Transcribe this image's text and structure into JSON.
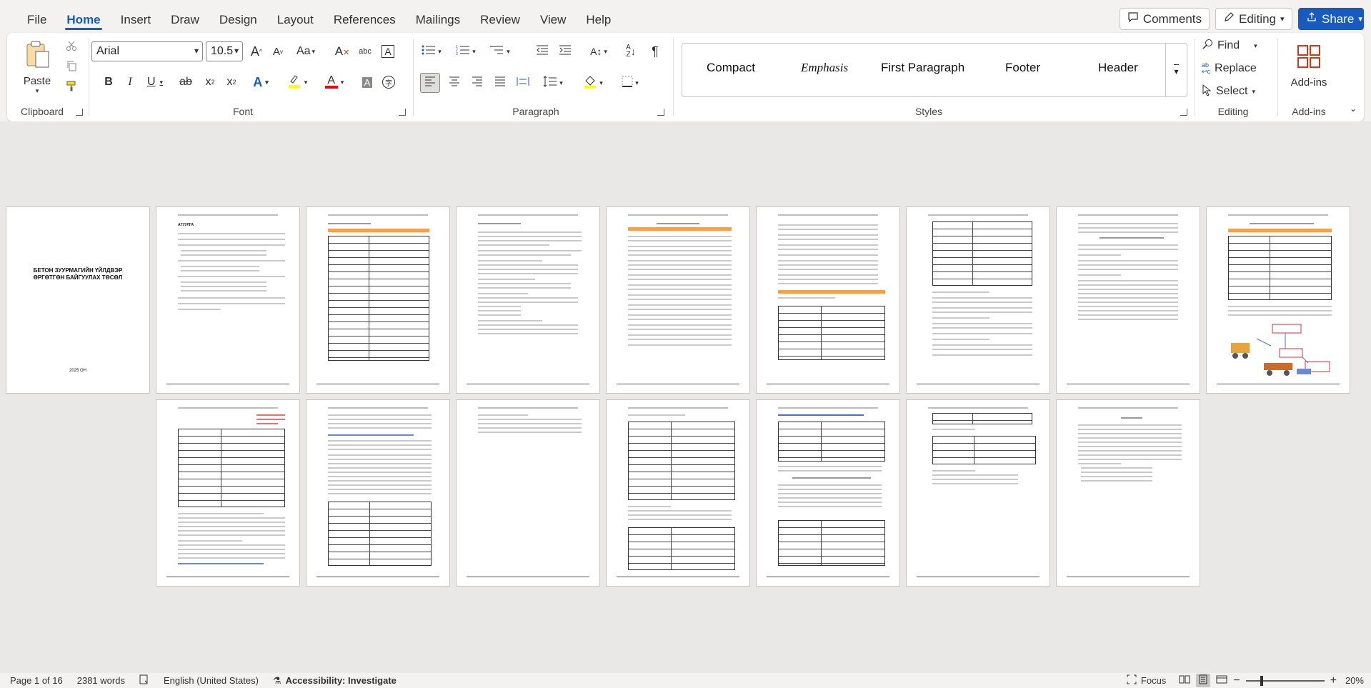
{
  "menu": {
    "tabs": [
      "File",
      "Home",
      "Insert",
      "Draw",
      "Design",
      "Layout",
      "References",
      "Mailings",
      "Review",
      "View",
      "Help"
    ],
    "active_tab": "Home",
    "comments_label": "Comments",
    "editing_label": "Editing",
    "share_label": "Share"
  },
  "ribbon": {
    "clipboard": {
      "label": "Clipboard",
      "paste_label": "Paste"
    },
    "font": {
      "label": "Font",
      "font_name": "Arial",
      "font_size": "10.5"
    },
    "paragraph": {
      "label": "Paragraph"
    },
    "styles": {
      "label": "Styles",
      "items": [
        "Compact",
        "Emphasis",
        "First Paragraph",
        "Footer",
        "Header"
      ]
    },
    "editing": {
      "label": "Editing",
      "find_label": "Find",
      "replace_label": "Replace",
      "select_label": "Select"
    },
    "addins": {
      "label": "Add-ins",
      "button_label": "Add-ins"
    }
  },
  "document": {
    "cover_title": "БЕТОН ЗУУРМАГИЙН ҮЙЛДВЭР ӨРГӨТГӨН БАЙГУУЛАХ ТӨСӨЛ",
    "cover_date": "2025 ОН",
    "toc_heading": "АГУУЛГА"
  },
  "status": {
    "page": "Page 1 of 16",
    "words": "2381 words",
    "language": "English (United States)",
    "accessibility": "Accessibility: Investigate",
    "focus_label": "Focus",
    "zoom": "20%"
  },
  "colors": {
    "accent": "#185abd",
    "highlight": "#ffff00",
    "font_color": "#ff0000",
    "bar": "#f4a14b"
  }
}
